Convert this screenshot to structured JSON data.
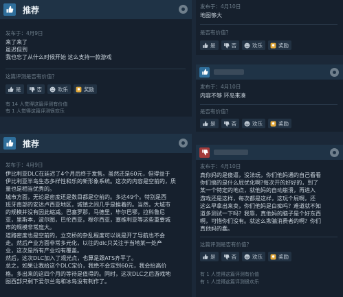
{
  "labels": {
    "recommended": "推荐",
    "helpful_q": "这篇评测是否有价值？",
    "helpful_q2": "是否有价值？",
    "yes": "是",
    "no": "否",
    "funny": "欢乐",
    "award": "奖励"
  },
  "reviews": {
    "r1": {
      "date": "发布于：4月9日",
      "lines": [
        "来了来了",
        "虽迟但到",
        "我也忘了从什么时候开始 这么支持一款游戏"
      ],
      "stat1": "有 14 人觉得这篇评测有价值",
      "stat2": "有 1 人觉得这篇评测很欢乐"
    },
    "r2": {
      "date": "发布于：4月9日",
      "lines": [
        "伊比利亚DLC在延迟了4个月后终于发售。虽然还是60元，但得益于",
        "伊比利亚半岛生态多样性和乐的新形象系统。这次的内容是空前的，质",
        "量也是相当优秀的。",
        "城市方面，无论是密度还是数目都是空前的。多达49个。特别是西",
        "班牙南部的安达卢西亚地区，城镇之间几乎是挨着的。当然，大城市",
        "的规模并没有因此缩减。巴塞罗那，马德里，毕尔巴鄂，拉科鲁尼",
        "亚，里斯本，波尔图，巴伦西亚，穆尔西亚，塞维利亚等这些重要城",
        "市的规模非常庞大。",
        "道路密度也是空前的，立交桥的杂乱程度可以说是开了导航也不会",
        "走。然后产业方面非常多元化，以往的dlc只关注于当地某一处产",
        "业，这次是所有产业均有覆盖。",
        "然后，这次DLC加入了观光点，也算是跟ATS齐平了。",
        "总之，如果让我给这个DLC定价，我绝不会定到60元，我会抬高价",
        "格。多出来的这四个月的等待是值得的。同时，这次DLC之后游戏地",
        "图西部只剩下爱尔兰岛和冰岛没有制作了。"
      ]
    },
    "r3": {
      "date": "发布于：4月10日",
      "lines": [
        "地图够大"
      ]
    },
    "r4": {
      "date": "发布于：4月10日",
      "lines": [
        "内容不够 环岛来凑"
      ]
    },
    "r5": {
      "date": "发布于：4月10日",
      "lines": [
        "真你妈的是傻逼，没法玩，你们他妈通的自己看看",
        "你们搞的是什么屁优化啊?每次开的好好的，到了",
        "某一个特定的地点，就他妈的自动崩溃，再进入",
        "游戏还是这样，每次都是这样，这玩个屁啊，还",
        "这么早拿出来卖，你们他妈是白痴吗？难道就不知",
        "道多测试一下吗？我靠，真他妈的脑子是个好东西",
        "啊，可惜你们没有。就这么欺骗消费者的啊？你们",
        "真他妈的蠢。"
      ],
      "stat1": "有 1 人觉得这篇评测有价值",
      "stat2": "有 1 人觉得这篇评测很欢乐"
    }
  }
}
